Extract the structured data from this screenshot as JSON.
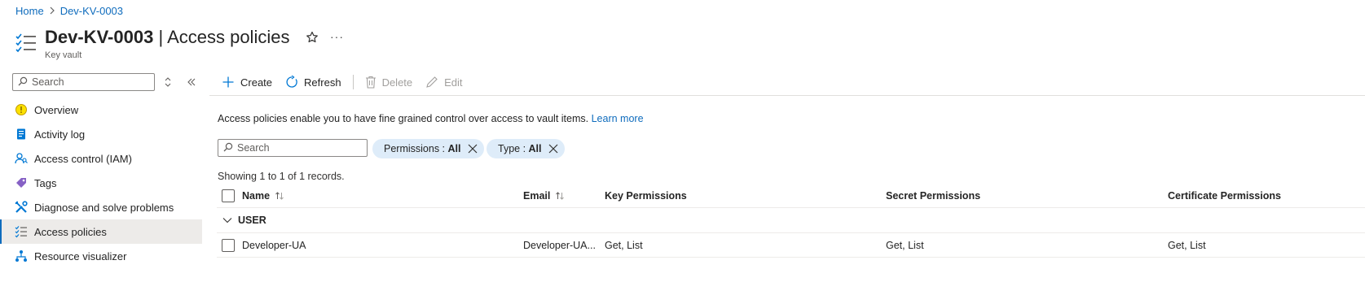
{
  "breadcrumb": {
    "home": "Home",
    "current": "Dev-KV-0003"
  },
  "header": {
    "title_resource": "Dev-KV-0003",
    "title_separator": "|",
    "title_page": "Access policies",
    "subtitle": "Key vault",
    "more": "···",
    "resource_icon": "access-policies-icon",
    "favorite_icon": "star-icon"
  },
  "sidebar": {
    "search_placeholder": "Search",
    "items": [
      {
        "label": "Overview",
        "icon": "overview-icon"
      },
      {
        "label": "Activity log",
        "icon": "activity-log-icon"
      },
      {
        "label": "Access control (IAM)",
        "icon": "iam-icon"
      },
      {
        "label": "Tags",
        "icon": "tag-icon"
      },
      {
        "label": "Diagnose and solve problems",
        "icon": "wrench-icon"
      },
      {
        "label": "Access policies",
        "icon": "access-policies-icon",
        "active": true
      },
      {
        "label": "Resource visualizer",
        "icon": "visualizer-icon"
      }
    ]
  },
  "toolbar": {
    "create": "Create",
    "refresh": "Refresh",
    "delete": "Delete",
    "edit": "Edit"
  },
  "description": {
    "text": "Access policies enable you to have fine grained control over access to vault items.",
    "link": "Learn more"
  },
  "filters": {
    "search_placeholder": "Search",
    "permissions_label": "Permissions :",
    "permissions_value": "All",
    "type_label": "Type :",
    "type_value": "All"
  },
  "records": "Showing 1 to 1 of 1 records.",
  "table": {
    "columns": [
      "Name",
      "Email",
      "Key Permissions",
      "Secret Permissions",
      "Certificate Permissions"
    ],
    "group": "USER",
    "rows": [
      {
        "name": "Developer-UA",
        "email": "Developer-UA...",
        "key": "Get, List",
        "secret": "Get, List",
        "certificate": "Get, List"
      }
    ]
  },
  "colors": {
    "accent": "#0f6cbd",
    "pill_bg": "#deecf9",
    "active_nav_bg": "#edebe9"
  }
}
